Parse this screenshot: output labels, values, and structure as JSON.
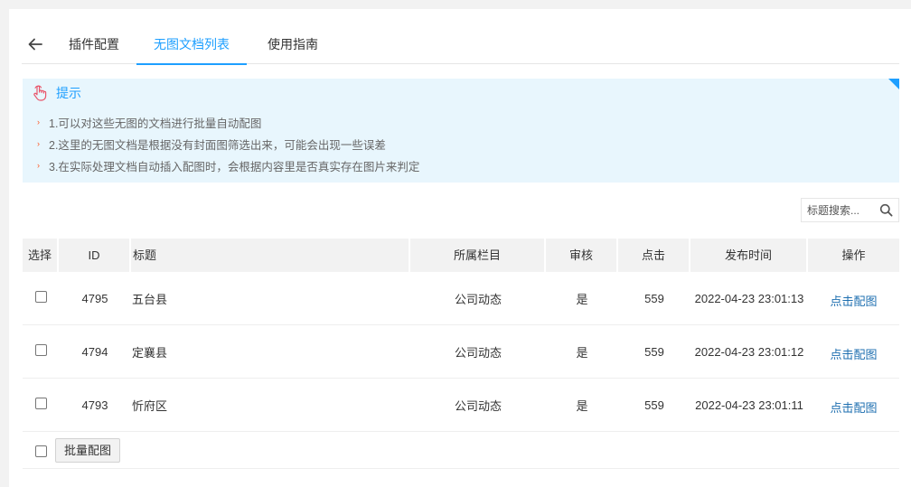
{
  "tabs": [
    {
      "label": "插件配置"
    },
    {
      "label": "无图文档列表"
    },
    {
      "label": "使用指南"
    }
  ],
  "accent_color": "#1e9fff",
  "tip": {
    "title": "提示",
    "items": [
      "1.可以对这些无图的文档进行批量自动配图",
      "2.这里的无图文档是根据没有封面图筛选出来，可能会出现一些误差",
      "3.在实际处理文档自动插入配图时，会根据内容里是否真实存在图片来判定"
    ]
  },
  "search": {
    "placeholder": "标题搜索..."
  },
  "table": {
    "headers": {
      "select": "选择",
      "id": "ID",
      "title": "标题",
      "column": "所属栏目",
      "audit": "审核",
      "clicks": "点击",
      "time": "发布时间",
      "op": "操作"
    },
    "rows": [
      {
        "id": "4795",
        "title": "五台县",
        "column": "公司动态",
        "audit": "是",
        "clicks": "559",
        "time": "2022-04-23 23:01:13",
        "op": "点击配图"
      },
      {
        "id": "4794",
        "title": "定襄县",
        "column": "公司动态",
        "audit": "是",
        "clicks": "559",
        "time": "2022-04-23 23:01:12",
        "op": "点击配图"
      },
      {
        "id": "4793",
        "title": "忻府区",
        "column": "公司动态",
        "audit": "是",
        "clicks": "559",
        "time": "2022-04-23 23:01:11",
        "op": "点击配图"
      }
    ]
  },
  "footer": {
    "batch_label": "批量配图"
  }
}
